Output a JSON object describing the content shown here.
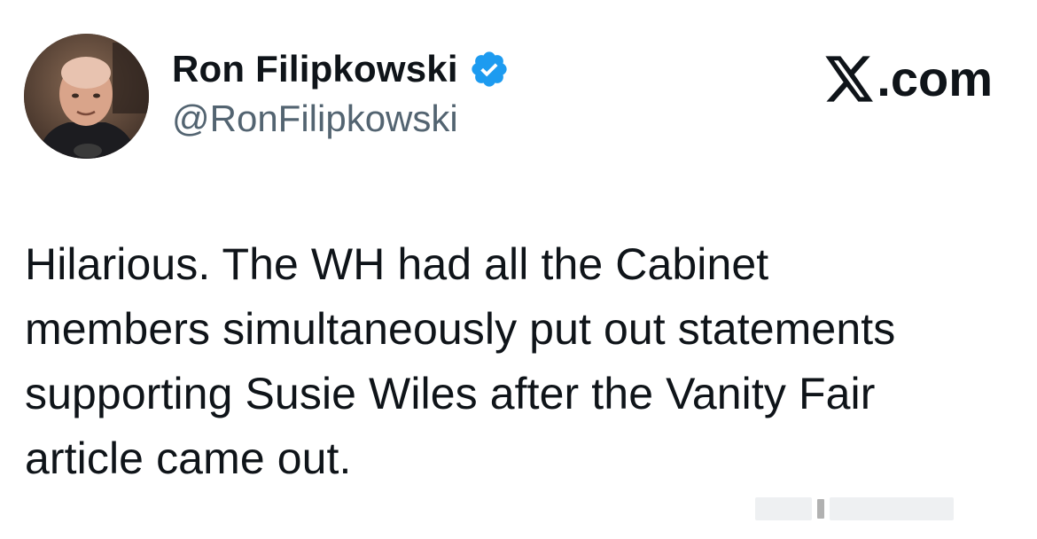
{
  "author": {
    "display_name": "Ron Filipkowski",
    "handle": "@RonFilipkowski",
    "verified": true
  },
  "brand": {
    "label": ".com",
    "icon": "x-logo-icon"
  },
  "tweet": {
    "text": "Hilarious. The WH had all the Cabinet\nmembers simultaneously put out statements\nsupporting Susie Wiles after the Vanity Fair\narticle came out."
  },
  "colors": {
    "text_primary": "#0f1419",
    "text_secondary": "#536471",
    "verified_badge": "#1d9bf0",
    "background": "#ffffff"
  },
  "icons": {
    "avatar": "avatar",
    "verified": "verified-badge-icon",
    "brand": "x-logo-icon"
  }
}
